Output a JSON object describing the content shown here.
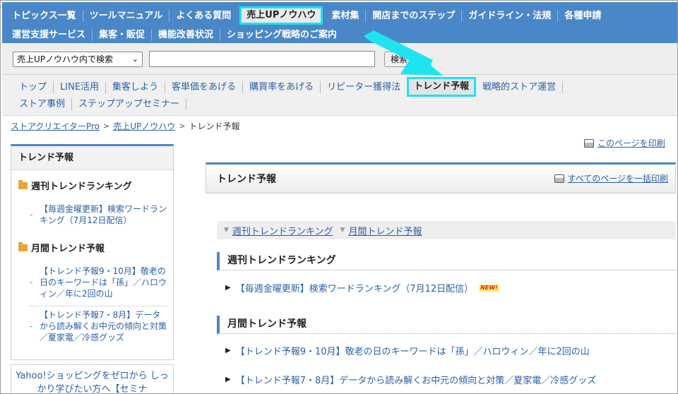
{
  "top_nav": {
    "row1": [
      "トピックス一覧",
      "ツールマニュアル",
      "よくある質問",
      "売上UPノウハウ",
      "素材集",
      "開店までのステップ",
      "ガイドライン・法規",
      "各種申請"
    ],
    "row2": [
      "運営支援サービス",
      "集客・販促",
      "機能改善状況",
      "ショッピング戦略のご案内"
    ],
    "active": "売上UPノウハウ"
  },
  "search": {
    "scope": "売上UPノウハウ内で検索",
    "value": "",
    "button": "検索"
  },
  "sub_nav": {
    "row1": [
      "トップ",
      "LINE活用",
      "集客しよう",
      "客単価をあげる",
      "購買率をあげる",
      "リピーター獲得法",
      "トレンド予報",
      "戦略的ストア運営"
    ],
    "row2": [
      "ストア事例",
      "ステップアップセミナー"
    ],
    "active": "トレンド予報"
  },
  "breadcrumb": {
    "items": [
      "ストアクリエイターPro",
      "売上UPノウハウ"
    ],
    "separator": ">",
    "current": "トレンド予報"
  },
  "sidebar": {
    "title": "トレンド予報",
    "categories": [
      {
        "label": "週刊トレンドランキング",
        "items": [
          "【毎週金曜更新】検索ワードランキング（7月12日配信）"
        ]
      },
      {
        "label": "月間トレンド予報",
        "items": [
          "【トレンド予報9・10月】敬老の日のキーワードは「孫」／ハロウィン／年に2回の山",
          "【トレンド予報7・8月】データから読み解くお中元の傾向と対策／夏家電／冷感グッズ"
        ]
      }
    ],
    "promo": "Yahoo!ショッピングをゼロから しっかり学びたい方へ【セミナ"
  },
  "main": {
    "print_page": "このページを印刷",
    "title": "トレンド予報",
    "print_all": "すべてのページを一括印刷",
    "anchors": [
      "週刊トレンドランキング",
      "月間トレンド予報"
    ],
    "sections": [
      {
        "title": "週刊トレンドランキング",
        "entries": [
          "【毎週金曜更新】検索ワードランキング（7月12日配信）"
        ],
        "badge": "NEW!"
      },
      {
        "title": "月間トレンド予報",
        "entries": [
          "【トレンド予報9・10月】敬老の日のキーワードは「孫」／ハロウィン／年に2回の山",
          "【トレンド予報7・8月】データから読み解くお中元の傾向と対策／夏家電／冷感グッズ"
        ]
      }
    ]
  },
  "colors": {
    "nav_blue": "#4a87c8",
    "highlight": "#1ee3f0",
    "link": "#2a5fa7"
  }
}
